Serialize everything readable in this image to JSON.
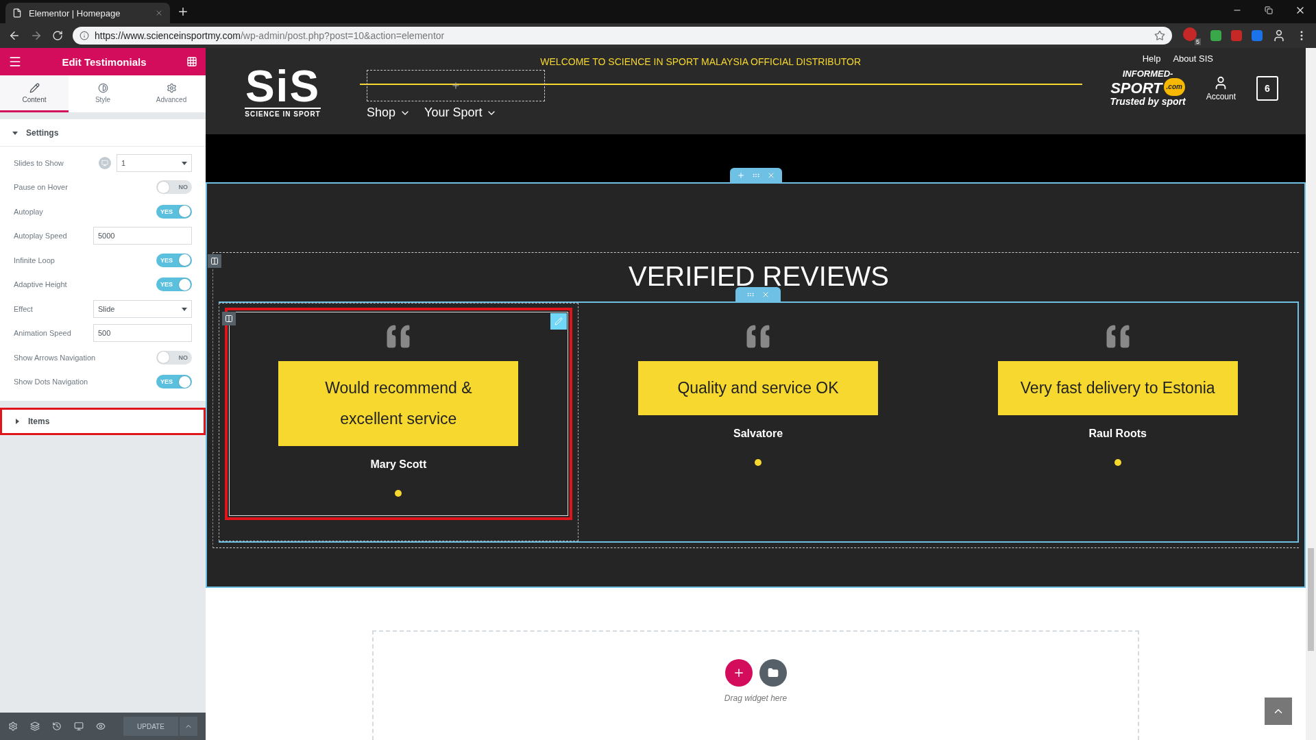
{
  "browser": {
    "tab_title": "Elementor | Homepage",
    "url_host": "https://www.scienceinsportmy.com",
    "url_path": "/wp-admin/post.php?post=10&action=elementor",
    "extension_badge": "5"
  },
  "panel": {
    "title": "Edit Testimonials",
    "tabs": [
      {
        "label": "Content",
        "kind": "pencil",
        "selected": true
      },
      {
        "label": "Style",
        "kind": "contrast",
        "selected": false
      },
      {
        "label": "Advanced",
        "kind": "gear",
        "selected": false
      }
    ],
    "settings_section": {
      "title": "Settings",
      "expanded": true
    },
    "controls": [
      {
        "kind": "select",
        "label": "Slides to Show",
        "value": "1",
        "responsive": true
      },
      {
        "kind": "toggle",
        "label": "Pause on Hover",
        "on": false,
        "state_label": "NO"
      },
      {
        "kind": "toggle",
        "label": "Autoplay",
        "on": true,
        "state_label": "YES"
      },
      {
        "kind": "input",
        "label": "Autoplay Speed",
        "value": "5000"
      },
      {
        "kind": "toggle",
        "label": "Infinite Loop",
        "on": true,
        "state_label": "YES"
      },
      {
        "kind": "toggle",
        "label": "Adaptive Height",
        "on": true,
        "state_label": "YES"
      },
      {
        "kind": "select",
        "label": "Effect",
        "value": "Slide",
        "responsive": false
      },
      {
        "kind": "input",
        "label": "Animation Speed",
        "value": "500"
      },
      {
        "kind": "toggle",
        "label": "Show Arrows Navigation",
        "on": false,
        "state_label": "NO"
      },
      {
        "kind": "toggle",
        "label": "Show Dots Navigation",
        "on": true,
        "state_label": "YES"
      }
    ],
    "items_section": {
      "title": "Items",
      "expanded": false,
      "selected": true
    },
    "footer": {
      "update_label": "UPDATE"
    }
  },
  "site": {
    "announcement": "WELCOME TO SCIENCE IN SPORT MALAYSIA OFFICIAL DISTRIBUTOR",
    "top_links": [
      "Help",
      "About SIS"
    ],
    "logo": {
      "mark": "SiS",
      "tagline": "SCIENCE IN SPORT"
    },
    "nav": [
      "Shop",
      "Your Sport"
    ],
    "partner": {
      "line1": "INFORMED-",
      "line2": "SPORT",
      "suffix": ".com",
      "tagline": "Trusted by sport"
    },
    "account_label": "Account",
    "cart_count": "6"
  },
  "section": {
    "heading": "VERIFIED REVIEWS",
    "testimonials": [
      {
        "text": "Would recommend & excellent service",
        "name": "Mary Scott",
        "selected": true
      },
      {
        "text": "Quality and service OK",
        "name": "Salvatore",
        "selected": false
      },
      {
        "text": "Very fast delivery to Estonia",
        "name": "Raul Roots",
        "selected": false
      }
    ]
  },
  "drop_zone": {
    "hint": "Drag widget here"
  }
}
